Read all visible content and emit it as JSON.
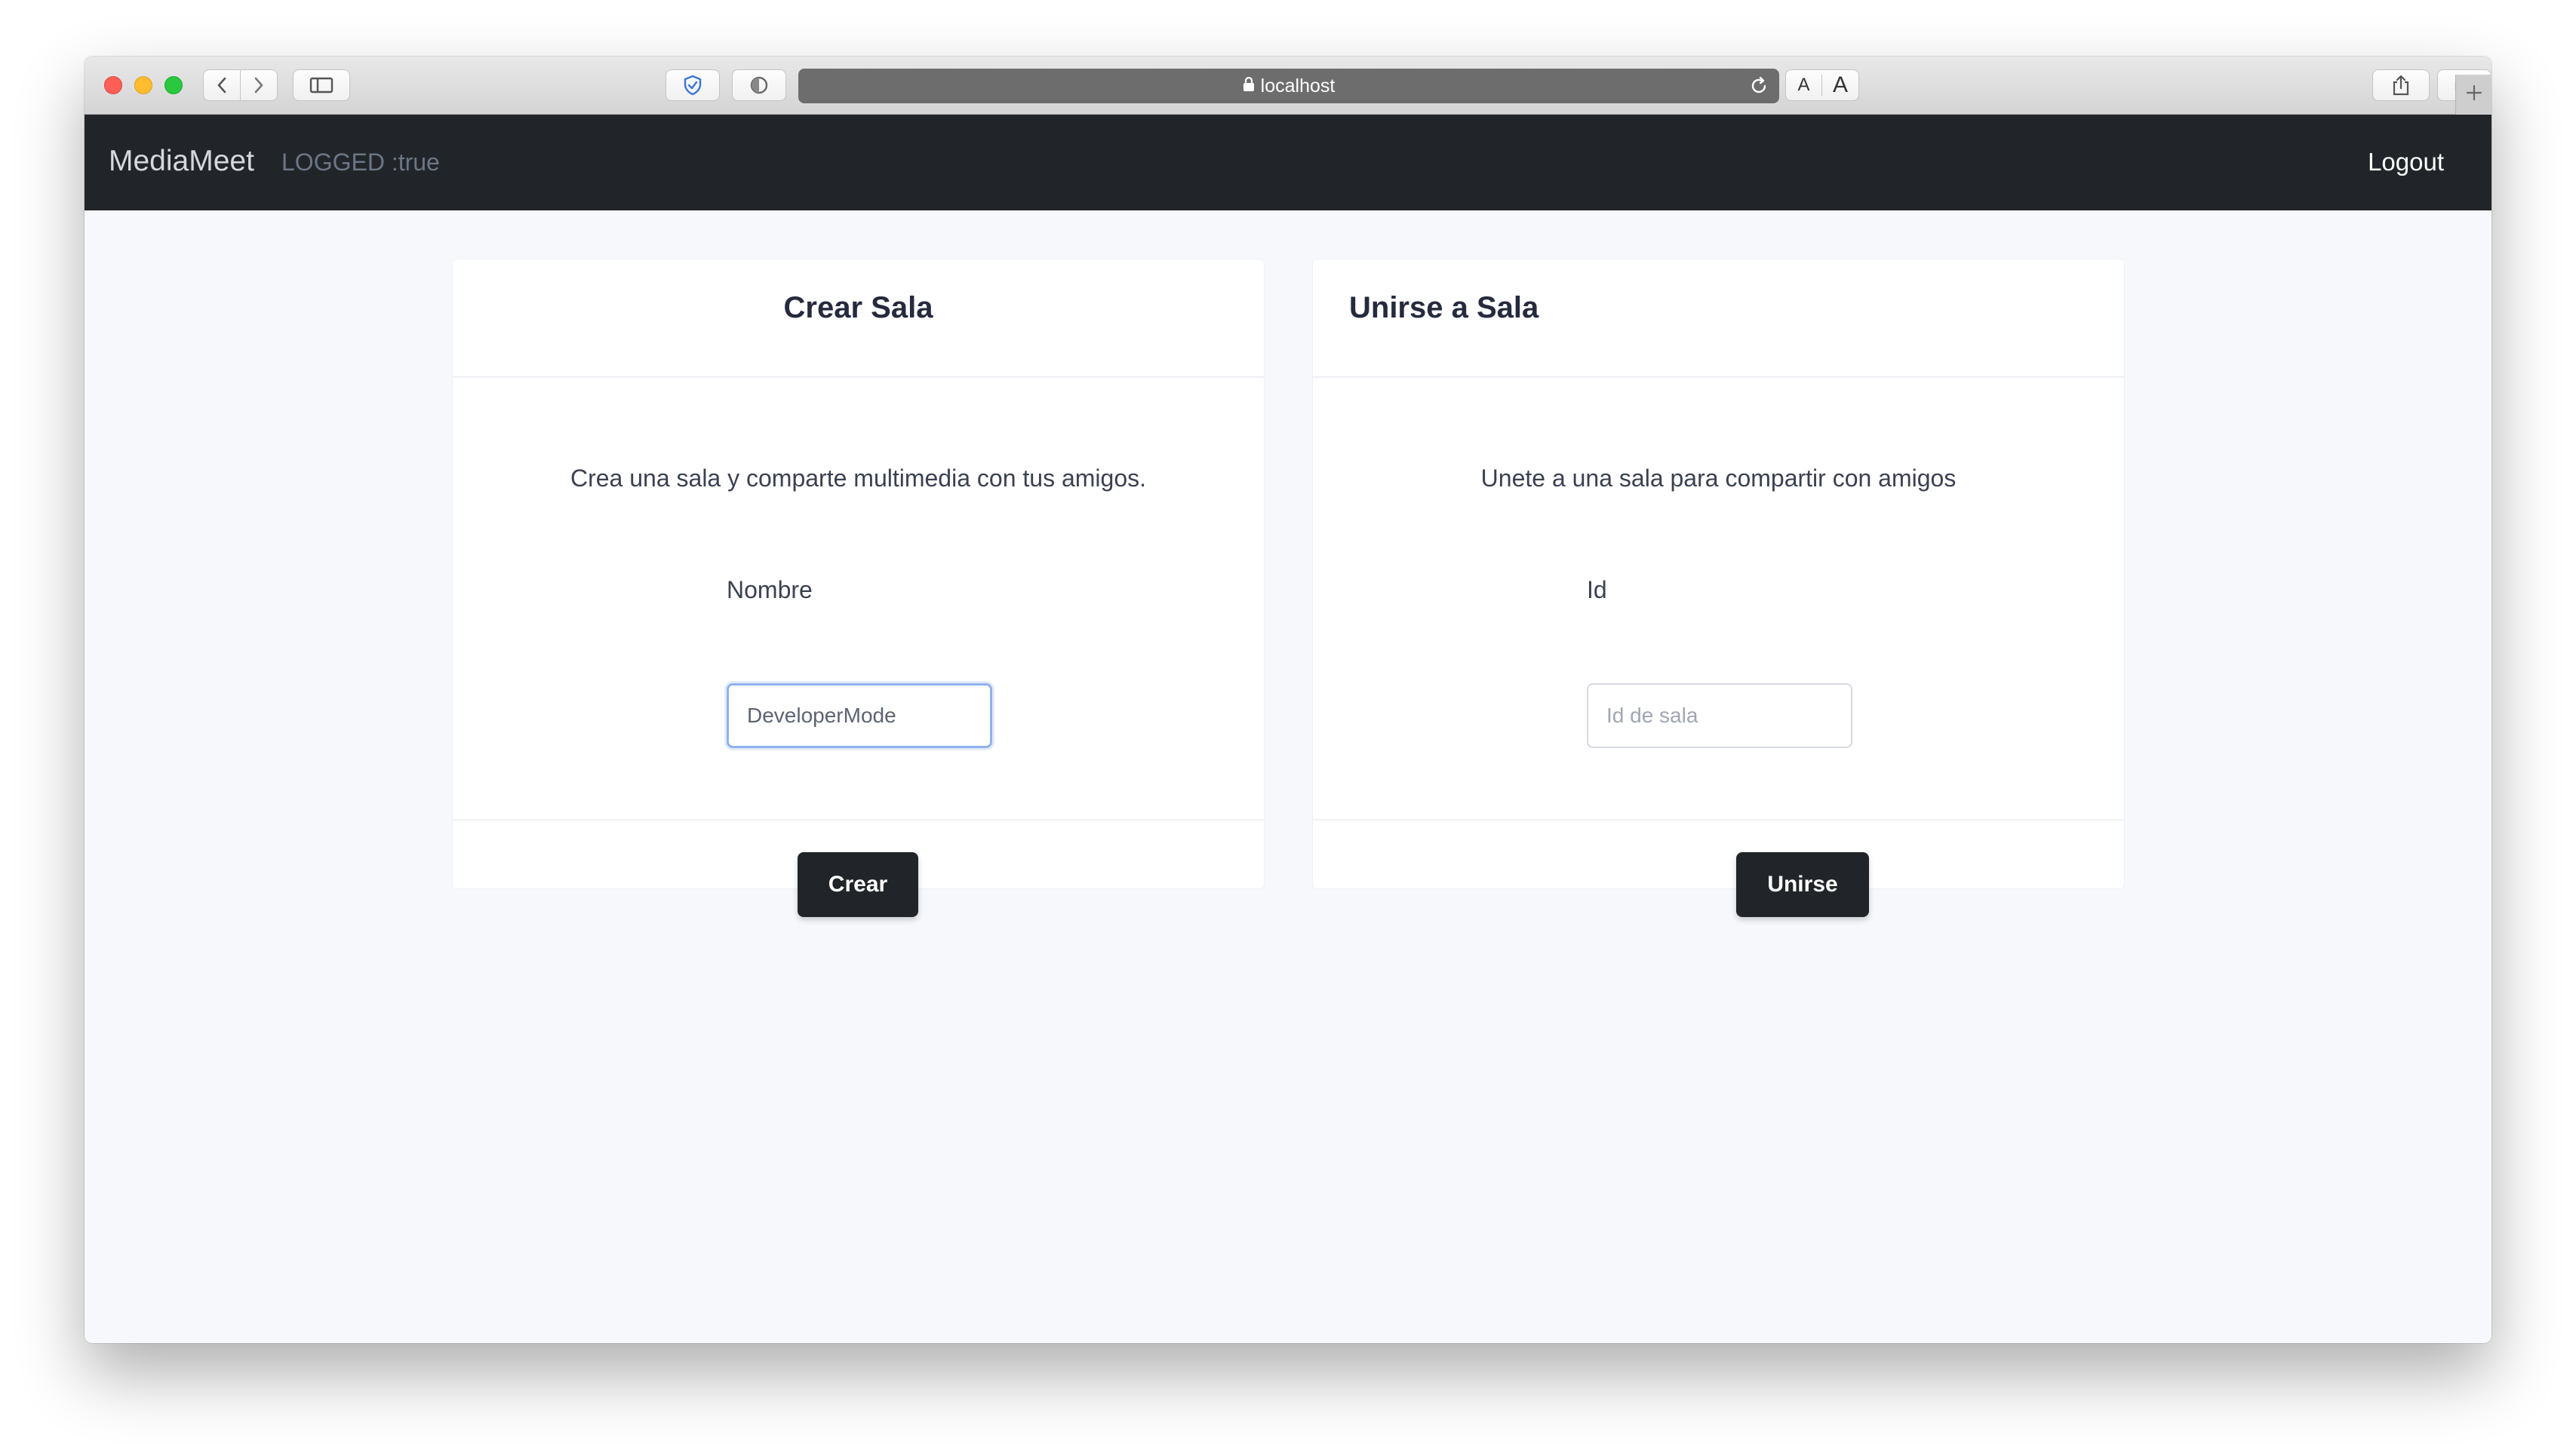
{
  "browser": {
    "url": "localhost",
    "text_size_small": "A",
    "text_size_large": "A"
  },
  "navbar": {
    "brand": "MediaMeet",
    "status": "LOGGED :true",
    "logout_label": "Logout"
  },
  "create_room": {
    "title": "Crear Sala",
    "description": "Crea una sala y comparte multimedia con tus amigos.",
    "field_label": "Nombre",
    "field_value": "DeveloperMode",
    "button_label": "Crear"
  },
  "join_room": {
    "title": "Unirse a Sala",
    "description": "Unete a una sala para compartir con amigos",
    "field_label": "Id",
    "field_placeholder": "Id de sala",
    "button_label": "Unirse"
  },
  "colors": {
    "navbar_bg": "#212529",
    "page_bg": "#f7f8fc",
    "button_bg": "#212529",
    "focus_ring": "#8fb2ee"
  }
}
